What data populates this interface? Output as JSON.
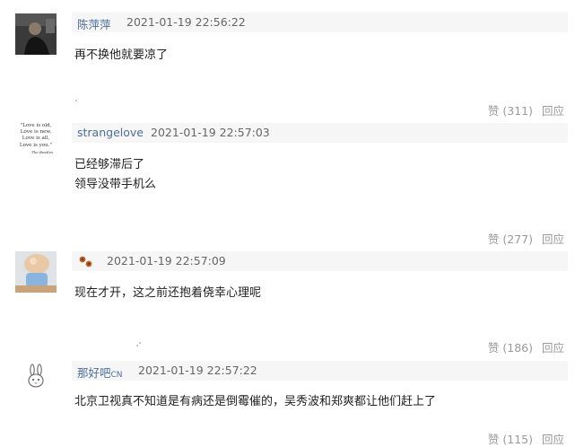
{
  "comments": [
    {
      "user": "陈萍萍",
      "time": "2021-01-19 22:56:22",
      "lines": [
        "再不换他就要凉了"
      ],
      "likes": "赞 (311)",
      "reply": "回应"
    },
    {
      "user": "strangelove",
      "time": "2021-01-19 22:57:03",
      "lines": [
        "已经够滞后了",
        "领导没带手机么"
      ],
      "likes": "赞 (277)",
      "reply": "回应",
      "avatar_text": [
        "\"Love is old,",
        "Love is new,",
        "Love is all,",
        "Love is you.\"",
        "-The Beatles"
      ]
    },
    {
      "user": "",
      "time": "2021-01-19 22:57:09",
      "lines": [
        "现在才开，这之前还抱着侥幸心理呢"
      ],
      "likes": "赞 (186)",
      "reply": "回应"
    },
    {
      "user": "那好吧",
      "user_suffix": "CN",
      "time": "2021-01-19 22:57:22",
      "lines": [
        "北京卫视真不知道是有病还是倒霉催的，吴秀波和郑爽都让他们赶上了"
      ],
      "likes": "赞 (115)",
      "reply": "回应"
    }
  ]
}
